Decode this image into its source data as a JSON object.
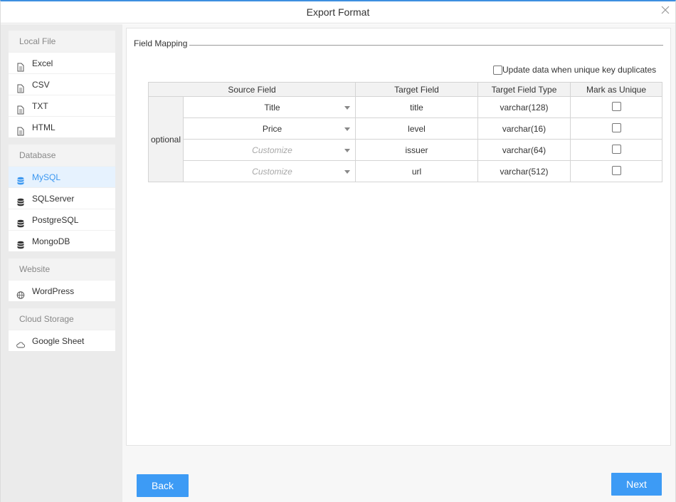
{
  "dialog": {
    "title": "Export Format"
  },
  "sidebar": {
    "groups": [
      {
        "header": "Local File",
        "items": [
          {
            "label": "Excel",
            "icon": "document-icon"
          },
          {
            "label": "CSV",
            "icon": "document-icon"
          },
          {
            "label": "TXT",
            "icon": "document-icon"
          },
          {
            "label": "HTML",
            "icon": "document-icon"
          }
        ]
      },
      {
        "header": "Database",
        "items": [
          {
            "label": "MySQL",
            "icon": "database-icon",
            "active": true
          },
          {
            "label": "SQLServer",
            "icon": "database-icon"
          },
          {
            "label": "PostgreSQL",
            "icon": "database-icon"
          },
          {
            "label": "MongoDB",
            "icon": "database-icon"
          }
        ]
      },
      {
        "header": "Website",
        "items": [
          {
            "label": "WordPress",
            "icon": "globe-icon"
          }
        ]
      },
      {
        "header": "Cloud Storage",
        "items": [
          {
            "label": "Google Sheet",
            "icon": "cloud-icon"
          }
        ]
      }
    ]
  },
  "main": {
    "section_label": "Field Mapping",
    "update_option": {
      "label": "Update data when unique key duplicates",
      "checked": false
    },
    "table": {
      "headers": [
        "Source Field",
        "Target Field",
        "Target Field Type",
        "Mark as Unique"
      ],
      "group_label": "optional",
      "rows": [
        {
          "source": "Title",
          "source_is_placeholder": false,
          "target": "title",
          "type": "varchar(128)",
          "unique": false
        },
        {
          "source": "Price",
          "source_is_placeholder": false,
          "target": "level",
          "type": "varchar(16)",
          "unique": false
        },
        {
          "source": "Customize",
          "source_is_placeholder": true,
          "target": "issuer",
          "type": "varchar(64)",
          "unique": false
        },
        {
          "source": "Customize",
          "source_is_placeholder": true,
          "target": "url",
          "type": "varchar(512)",
          "unique": false
        }
      ]
    }
  },
  "footer": {
    "back_label": "Back",
    "next_label": "Next"
  },
  "colors": {
    "accent": "#3d9bf5",
    "active_bg": "#e6f2fe",
    "active_text": "#3b97f0"
  }
}
